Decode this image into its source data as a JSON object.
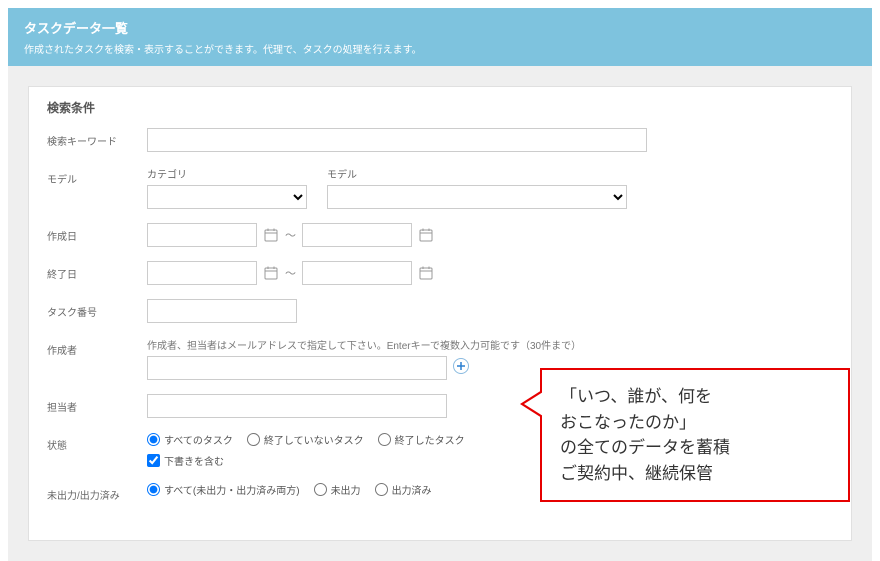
{
  "header": {
    "title": "タスクデータ一覧",
    "subtitle": "作成されたタスクを検索・表示することができます。代理で、タスクの処理を行えます。"
  },
  "panel": {
    "title": "検索条件"
  },
  "form": {
    "keyword": {
      "label": "検索キーワード",
      "value": ""
    },
    "model": {
      "label": "モデル",
      "category_sublabel": "カテゴリ",
      "model_sublabel": "モデル",
      "category_value": "",
      "model_value": ""
    },
    "created": {
      "label": "作成日",
      "from": "",
      "to": ""
    },
    "finished": {
      "label": "終了日",
      "from": "",
      "to": ""
    },
    "task_no": {
      "label": "タスク番号",
      "value": ""
    },
    "creator": {
      "label": "作成者",
      "helper": "作成者、担当者はメールアドレスで指定して下さい。Enterキーで複数入力可能です（30件まで）",
      "value": ""
    },
    "assignee": {
      "label": "担当者",
      "value": ""
    },
    "status": {
      "label": "状態",
      "options": [
        "すべてのタスク",
        "終了していないタスク",
        "終了したタスク"
      ],
      "selected": 0,
      "include_draft_label": "下書きを含む",
      "include_draft_checked": true
    },
    "output": {
      "label": "未出力/出力済み",
      "options": [
        "すべて(未出力・出力済み両方)",
        "未出力",
        "出力済み"
      ],
      "selected": 0
    },
    "date_sep": "〜"
  },
  "annotation": {
    "line1": "「いつ、誰が、何を",
    "line2": "おこなったのか」",
    "line3": "の全てのデータを蓄積",
    "line4": "ご契約中、継続保管"
  }
}
